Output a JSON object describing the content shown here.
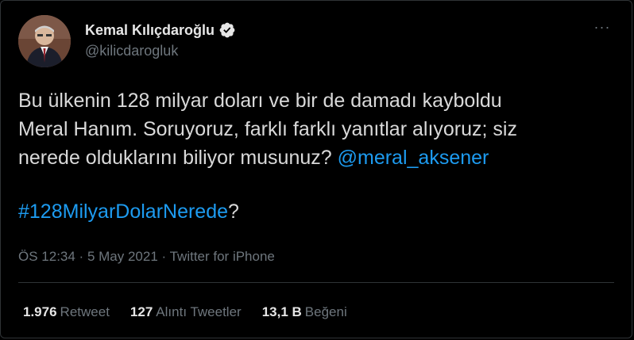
{
  "author": {
    "display_name": "Kemal Kılıçdaroğlu",
    "handle": "@kilicdarogluk",
    "verified": true
  },
  "menu": {
    "more_icon": "more-horizontal-icon",
    "more_glyph": "···"
  },
  "tweet": {
    "line1": "Bu ülkenin 128 milyar doları ve bir de damadı kayboldu",
    "line2": "Meral Hanım. Soruyoruz, farklı farklı yanıtlar alıyoruz; siz",
    "line3_text": "nerede olduklarını biliyor musunuz? ",
    "mention": "@meral_aksener",
    "hashtag": "#128MilyarDolarNerede",
    "hashtag_suffix": "?"
  },
  "meta": {
    "time": "ÖS 12:34",
    "separator1": " · ",
    "date": "5 May 2021",
    "separator2": " · ",
    "source": "Twitter for iPhone"
  },
  "stats": [
    {
      "value": "1.976",
      "label": "Retweet"
    },
    {
      "value": "127",
      "label": "Alıntı Tweetler"
    },
    {
      "value": "13,1 B",
      "label": "Beğeni"
    }
  ],
  "colors": {
    "background": "#000000",
    "text": "#d9d9d9",
    "link": "#1d9bf0",
    "muted": "#6e767d",
    "divider": "#2f3336"
  }
}
